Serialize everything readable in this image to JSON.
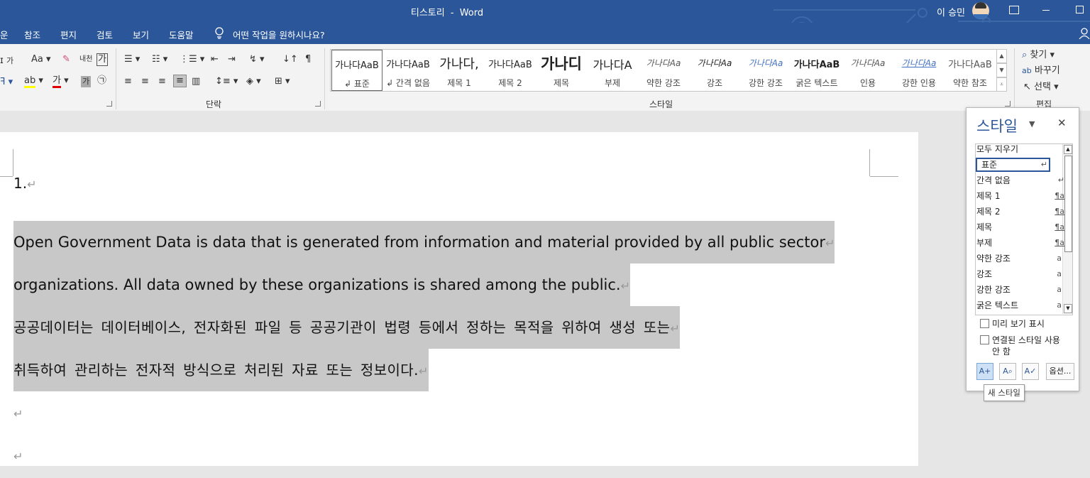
{
  "window": {
    "title": "티스토리",
    "title_sep": "-",
    "app": "Word",
    "user": "이 승민"
  },
  "menu": {
    "tabs": [
      "운",
      "참조",
      "편지",
      "검토",
      "보기",
      "도움말"
    ],
    "tell_me": "어떤 작업을 원하시나요?"
  },
  "ribbon": {
    "font_glyphs": {
      "aa": "Aa",
      "ga": "가",
      "hanja": "내천",
      "boxed_ga": "가",
      "circled": "㉠",
      "gray_ga": "가",
      "aa_under": "가"
    },
    "paragraph_label": "단락",
    "styles_label": "스타일",
    "editing_label": "편집",
    "find_label": "찾기",
    "replace_label": "바꾸기",
    "select_label": "선택"
  },
  "gallery": [
    {
      "preview": "가나다AaB",
      "name": "↲ 표준"
    },
    {
      "preview": "가나다AaB",
      "name": "↲ 간격 없음"
    },
    {
      "preview": "가나다,",
      "name": "제목 1"
    },
    {
      "preview": "가나다AaB",
      "name": "제목 2"
    },
    {
      "preview": "가나디",
      "name": "제목"
    },
    {
      "preview": "가나다A",
      "name": "부제"
    },
    {
      "preview": "가나다Aa",
      "name": "약한 강조"
    },
    {
      "preview": "가나다Aa",
      "name": "강조"
    },
    {
      "preview": "가나다Aa",
      "name": "강한 강조"
    },
    {
      "preview": "가나다AaB",
      "name": "굵은 텍스트"
    },
    {
      "preview": "가나다Aa",
      "name": "인용"
    },
    {
      "preview": "가나다Aa",
      "name": "강한 인용"
    },
    {
      "preview": "가나다AaB",
      "name": "약한 참조"
    }
  ],
  "document": {
    "number": "1.",
    "en_line1": "Open Government Data is data that is generated from information and material provided by all public sector",
    "en_line2": "organizations. All data owned by these organizations is shared among the public.",
    "ko_line1": "공공데이터는 데이터베이스, 전자화된 파일 등 공공기관이 법령 등에서 정하는 목적을 위하여 생성 또는",
    "ko_line2": "취득하여 관리하는 전자적 방식으로 처리된 자료 또는 정보이다.",
    "para_mark": "↵"
  },
  "style_pane": {
    "title": "스타일",
    "close": "✕",
    "items": [
      {
        "name": "모두 지우기",
        "mark": ""
      },
      {
        "name": "표준",
        "mark": "↵"
      },
      {
        "name": "간격 없음",
        "mark": "↵"
      },
      {
        "name": "제목 1",
        "mark": "¶a"
      },
      {
        "name": "제목 2",
        "mark": "¶a"
      },
      {
        "name": "제목",
        "mark": "¶a"
      },
      {
        "name": "부제",
        "mark": "¶a"
      },
      {
        "name": "약한 강조",
        "mark": "a"
      },
      {
        "name": "강조",
        "mark": "a"
      },
      {
        "name": "강한 강조",
        "mark": "a"
      },
      {
        "name": "굵은 텍스트",
        "mark": "a"
      }
    ],
    "show_preview": "미리 보기 표시",
    "disable_linked_1": "연결된 스타일 사용",
    "disable_linked_2": "안 함",
    "options": "옵션...",
    "tooltip": "새 스타일"
  }
}
